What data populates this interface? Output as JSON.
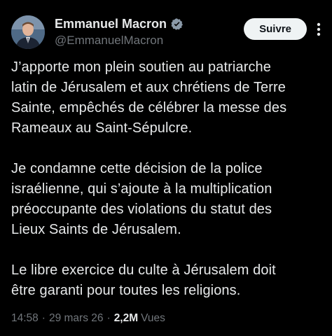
{
  "author": {
    "display_name": "Emmanuel Macron",
    "handle": "@EmmanuelMacron",
    "verified_icon": "verified-badge-icon",
    "verified_color": "#8a99a8"
  },
  "actions": {
    "follow_label": "Suivre",
    "more_icon": "more-options-icon"
  },
  "tweet": {
    "paragraphs": [
      "J’apporte mon plein soutien au patriarche\nlatin de Jérusalem et aux chrétiens de Terre\nSainte, empêchés de célébrer la messe des\nRameaux au Saint-Sépulcre.",
      "Je condamne cette décision de la police\nisraélienne, qui s’ajoute à la multiplication\npréoccupante des violations du statut des\nLieux Saints de Jérusalem.",
      "Le libre exercice du culte à Jérusalem doit\nêtre garanti pour toutes les religions."
    ]
  },
  "meta": {
    "time": "14:58",
    "separator": "·",
    "date": "29 mars 26",
    "views_count": "2,2M",
    "views_label": "Vues"
  },
  "colors": {
    "background": "#000000",
    "text": "#e7e9ea",
    "secondary_text": "#71767b",
    "button_bg": "#eff3f4"
  }
}
